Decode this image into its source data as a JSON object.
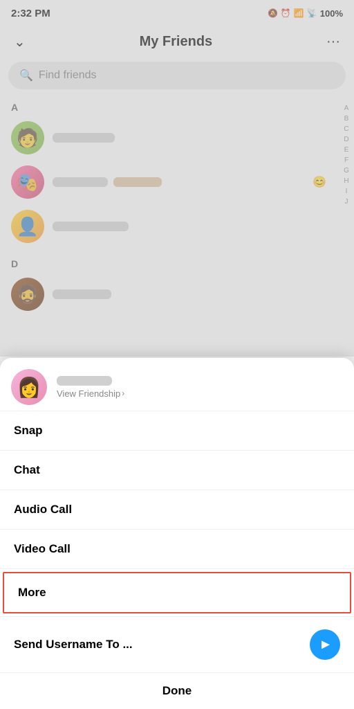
{
  "statusBar": {
    "time": "2:32 PM",
    "battery": "100%"
  },
  "header": {
    "title": "My Friends",
    "backLabel": "‹",
    "moreLabel": "···"
  },
  "search": {
    "placeholder": "Find friends"
  },
  "sections": [
    {
      "letter": "A",
      "friends": [
        {
          "id": "friend-a1",
          "avatarType": "green"
        },
        {
          "id": "friend-a2",
          "avatarType": "anime"
        },
        {
          "id": "friend-a3",
          "avatarType": "gold"
        }
      ]
    },
    {
      "letter": "D",
      "friends": [
        {
          "id": "friend-d1",
          "avatarType": "dark"
        }
      ]
    }
  ],
  "alphabetIndex": [
    "A",
    "B",
    "C",
    "D",
    "E",
    "F",
    "G",
    "H",
    "I",
    "J"
  ],
  "bottomSheet": {
    "viewFriendship": "View Friendship",
    "menuItems": [
      {
        "id": "snap",
        "label": "Snap"
      },
      {
        "id": "chat",
        "label": "Chat"
      },
      {
        "id": "audio-call",
        "label": "Audio Call"
      },
      {
        "id": "video-call",
        "label": "Video Call"
      }
    ],
    "moreLabel": "More",
    "sendLabel": "Send Username To ...",
    "doneLabel": "Done"
  }
}
